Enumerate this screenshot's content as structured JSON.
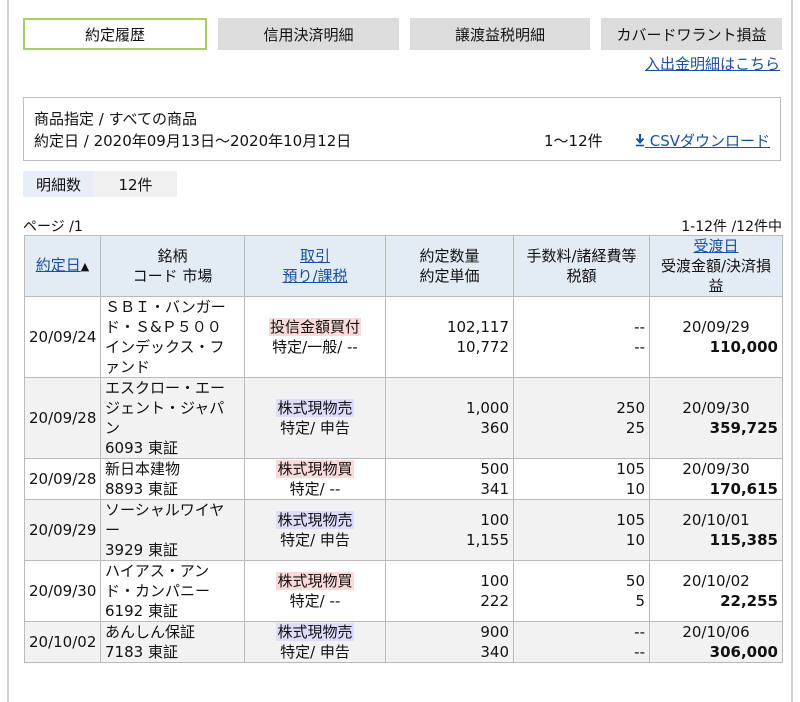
{
  "tabs": [
    {
      "label": "約定履歴",
      "active": true
    },
    {
      "label": "信用決済明細",
      "active": false
    },
    {
      "label": "譲渡益税明細",
      "active": false
    },
    {
      "label": "カバードワラント損益",
      "active": false
    }
  ],
  "deposit_link": "入出金明細はこちら",
  "filter": {
    "product": "商品指定 / すべての商品",
    "period": "約定日 / 2020年09月13日〜2020年10月12日",
    "count": "1〜12件",
    "csv_icon": "download-arrow-icon",
    "csv_label": "CSVダウンロード"
  },
  "summary": {
    "label": "明細数",
    "value": "12件"
  },
  "page_info": "ページ /1",
  "range_info": "1-12件 /12件中",
  "headers": {
    "date": "約定日",
    "date_sort_icon": "sort-triangle-icon",
    "name_line1": "銘柄",
    "name_line2": "コード  市場",
    "kind_line1": "取引",
    "kind_line2": "預り/課税",
    "qty_line1": "約定数量",
    "qty_line2": "約定単価",
    "fee_line1": "手数料/諸経費等",
    "fee_line2": "税額",
    "settle_line1": "受渡日",
    "settle_line2": "受渡金額/決済損益"
  },
  "rows": [
    {
      "date": "20/09/24",
      "name_lines": [
        "ＳＢＩ・バンガー",
        "ド・Ｓ&Ｐ５００",
        "インデックス・フ",
        "ァンド"
      ],
      "code": "",
      "trade": "投信金額買付",
      "trade_type": "buy",
      "account": "特定/一般/ --",
      "qty": "102,117",
      "price": "10,772",
      "fee": "--",
      "tax": "--",
      "settle_date": "20/09/29",
      "amount": "110,000",
      "shade": "white"
    },
    {
      "date": "20/09/28",
      "name_lines": [
        "エスクロー・エー",
        "ジェント・ジャパ",
        "ン"
      ],
      "code": "6093  東証",
      "trade": "株式現物売",
      "trade_type": "sell",
      "account": "特定/ 申告",
      "qty": "1,000",
      "price": "360",
      "fee": "250",
      "tax": "25",
      "settle_date": "20/09/30",
      "amount": "359,725",
      "shade": "gray"
    },
    {
      "date": "20/09/28",
      "name_lines": [
        "新日本建物"
      ],
      "code": "8893  東証",
      "trade": "株式現物買",
      "trade_type": "buy",
      "account": "特定/ --",
      "qty": "500",
      "price": "341",
      "fee": "105",
      "tax": "10",
      "settle_date": "20/09/30",
      "amount": "170,615",
      "shade": "white"
    },
    {
      "date": "20/09/29",
      "name_lines": [
        "ソーシャルワイヤ",
        "ー"
      ],
      "code": "3929  東証",
      "trade": "株式現物売",
      "trade_type": "sell",
      "account": "特定/ 申告",
      "qty": "100",
      "price": "1,155",
      "fee": "105",
      "tax": "10",
      "settle_date": "20/10/01",
      "amount": "115,385",
      "shade": "gray"
    },
    {
      "date": "20/09/30",
      "name_lines": [
        "ハイアス・アン",
        "ド・カンパニー"
      ],
      "code": "6192  東証",
      "trade": "株式現物買",
      "trade_type": "buy",
      "account": "特定/ --",
      "qty": "100",
      "price": "222",
      "fee": "50",
      "tax": "5",
      "settle_date": "20/10/02",
      "amount": "22,255",
      "shade": "white"
    },
    {
      "date": "20/10/02",
      "name_lines": [
        "あんしん保証"
      ],
      "code": "7183  東証",
      "trade": "株式現物売",
      "trade_type": "sell",
      "account": "特定/ 申告",
      "qty": "900",
      "price": "340",
      "fee": "--",
      "tax": "--",
      "settle_date": "20/10/06",
      "amount": "306,000",
      "shade": "gray"
    }
  ],
  "colors": {
    "tab_active_border": "#a8d060",
    "tab_bg": "#dcdcdc",
    "header_bg": "#e3ebf5",
    "link": "#1a4fa0",
    "buy_highlight": "#fbd9d9",
    "sell_highlight": "#dcdcfb",
    "row_gray": "#f2f2f2"
  }
}
